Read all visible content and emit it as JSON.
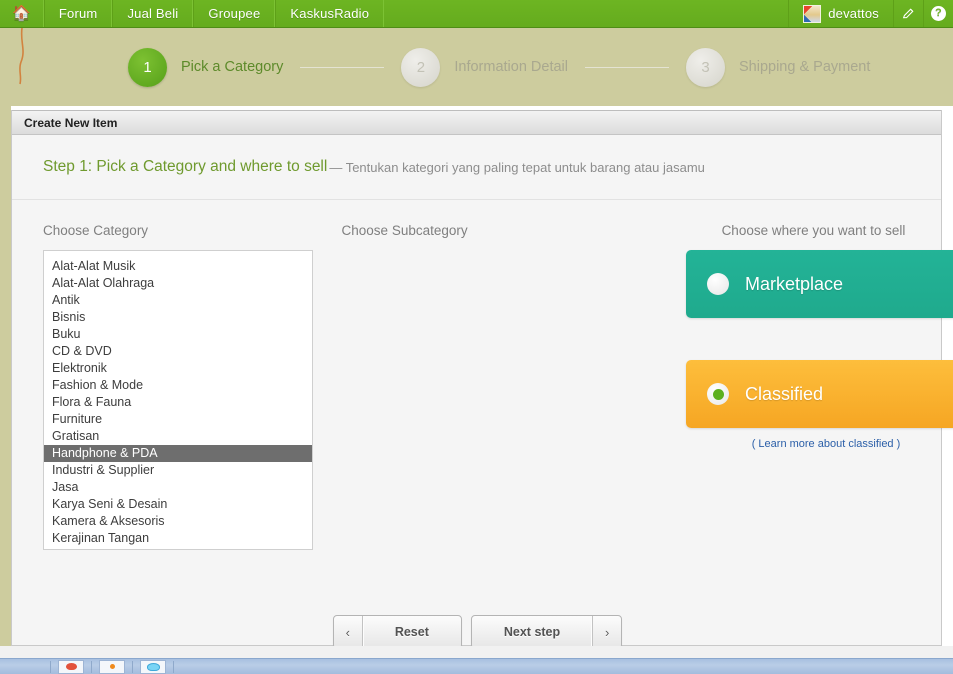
{
  "topnav": {
    "home_icon": "home-icon",
    "items": [
      {
        "label": "Forum"
      },
      {
        "label": "Jual Beli"
      },
      {
        "label": "Groupee"
      },
      {
        "label": "KaskusRadio"
      }
    ],
    "username": "devattos",
    "avatar_icon": "avatar-thumbnail",
    "compose_icon": "pencil-icon",
    "help_icon": "question-mark-icon",
    "help_label": "?"
  },
  "stepper": {
    "steps": [
      {
        "number": "1",
        "label": "Pick a Category",
        "state": "active"
      },
      {
        "number": "2",
        "label": "Information Detail",
        "state": "idle"
      },
      {
        "number": "3",
        "label": "Shipping & Payment",
        "state": "idle"
      }
    ]
  },
  "panel": {
    "header": "Create New Item",
    "step_title": "Step 1: Pick a Category and where to sell",
    "step_subtitle": "— Tentukan kategori yang paling tepat untuk barang atau jasamu"
  },
  "category": {
    "label": "Choose Category",
    "selected": "Handphone & PDA",
    "items": [
      "Alat-Alat Musik",
      "Alat-Alat Olahraga",
      "Antik",
      "Bisnis",
      "Buku",
      "CD & DVD",
      "Elektronik",
      "Fashion & Mode",
      "Flora & Fauna",
      "Furniture",
      "Gratisan",
      "Handphone & PDA",
      "Industri & Supplier",
      "Jasa",
      "Karya Seni & Desain",
      "Kamera & Aksesoris",
      "Kerajinan Tangan"
    ]
  },
  "subcategory": {
    "label": "Choose Subcategory",
    "items": []
  },
  "sell": {
    "label": "Choose where you want to sell",
    "options": [
      {
        "name": "Marketplace",
        "selected": false,
        "color": "#1faa8d"
      },
      {
        "name": "Classified",
        "selected": true,
        "color": "#f6a623"
      }
    ],
    "learn_more": "( Learn more about classified )"
  },
  "footer": {
    "prev_chevron": "‹",
    "reset_label": "Reset",
    "next_label": "Next step",
    "next_chevron": "›"
  },
  "taskbar": {
    "quicklaunch": [
      "browser-icon",
      "messenger-icon",
      "media-icon"
    ]
  },
  "colors": {
    "nav_green": "#6db522",
    "band_khaki": "#cdcc9e",
    "accent_green": "#6f9a2e",
    "marketplace_teal": "#1faa8d",
    "classified_orange": "#f6a623",
    "link_blue": "#2b5fa8",
    "selected_row": "#6e6e6e"
  }
}
